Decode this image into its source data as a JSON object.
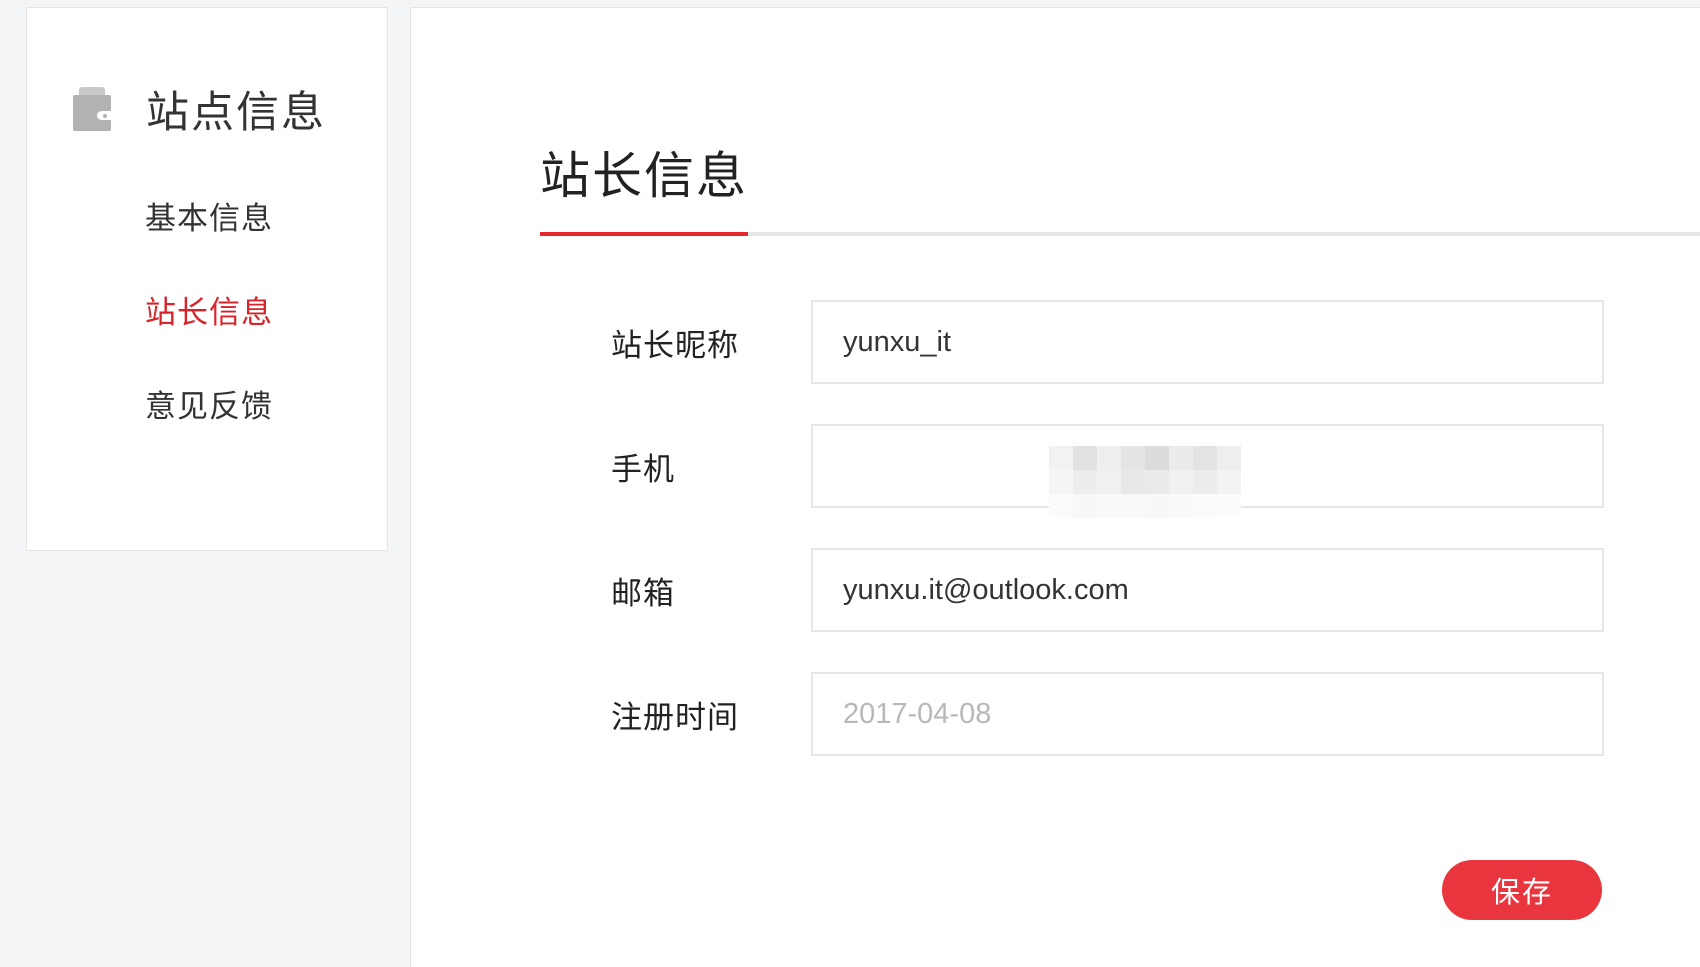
{
  "sidebar": {
    "title": "站点信息",
    "icon": "wallet-icon",
    "items": [
      {
        "label": "基本信息",
        "active": false
      },
      {
        "label": "站长信息",
        "active": true
      },
      {
        "label": "意见反馈",
        "active": false
      }
    ]
  },
  "main": {
    "tab_title": "站长信息",
    "fields": {
      "nickname": {
        "label": "站长昵称",
        "value": "yunxu_it"
      },
      "phone": {
        "label": "手机",
        "value": ""
      },
      "email": {
        "label": "邮箱",
        "value": "yunxu.it@outlook.com"
      },
      "register_time": {
        "label": "注册时间",
        "value": "2017-04-08"
      }
    },
    "save_label": "保存"
  },
  "colors": {
    "accent": "#e8262f",
    "active_nav": "#d8232a",
    "background": "#f4f5f7"
  }
}
